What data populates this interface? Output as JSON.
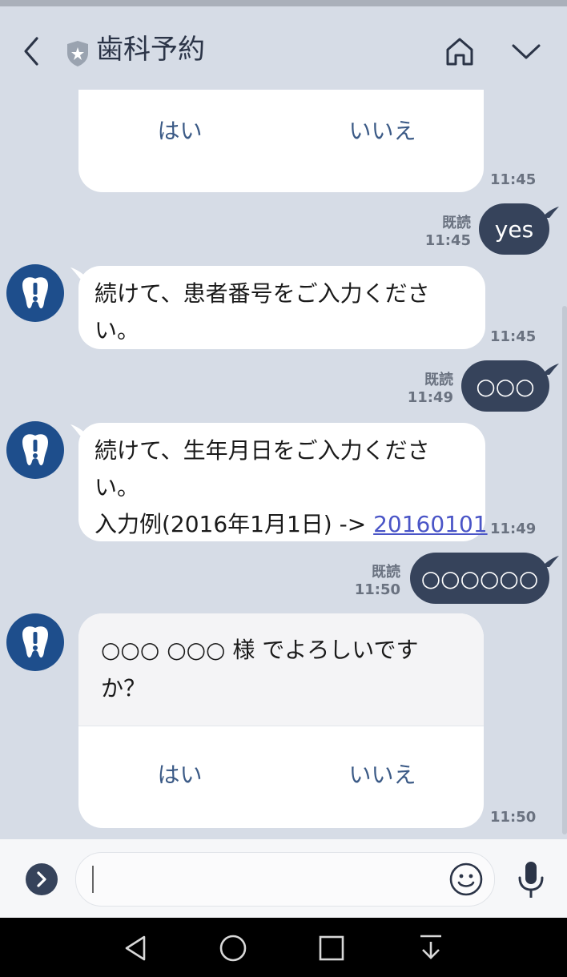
{
  "header": {
    "title": "歯科予約",
    "icons": [
      "back-icon",
      "shield-star-icon",
      "home-icon",
      "chevron-down-icon"
    ]
  },
  "colors": {
    "background": "#d6dce6",
    "outgoing_bubble": "#36435b",
    "incoming_bubble": "#ffffff",
    "card_button_text": "#3b5a86",
    "link": "#4a55c7",
    "avatar": "#1e4e8c"
  },
  "messages": {
    "card1": {
      "yes_label": "はい",
      "no_label": "いいえ",
      "time": "11:45"
    },
    "out1": {
      "text": "yes",
      "read": "既読",
      "time": "11:45"
    },
    "in1": {
      "line1": "続けて、患者番号をご入力くださ",
      "line2": "い。",
      "time": "11:45"
    },
    "out2": {
      "text": "○○○",
      "read": "既読",
      "time": "11:49"
    },
    "in2": {
      "line1": "続けて、生年月日をご入力くださ",
      "line2": "い。",
      "line3_prefix": "入力例(2016年1月1日) -> ",
      "line3_link": "20160101",
      "time": "11:49"
    },
    "out3": {
      "text": "○○○○○○",
      "read": "既読",
      "time": "11:50"
    },
    "card2": {
      "line1": "○○○ ○○○ 様 でよろしいです",
      "line2": "か？",
      "yes_label": "はい",
      "no_label": "いいえ",
      "time": "11:50"
    }
  },
  "input": {
    "value": "",
    "icons": [
      "menu-toggle-icon",
      "emoji-icon",
      "microphone-icon"
    ]
  },
  "navbar": {
    "icons": [
      "nav-back-icon",
      "nav-home-icon",
      "nav-recents-icon",
      "nav-notifications-icon"
    ]
  }
}
